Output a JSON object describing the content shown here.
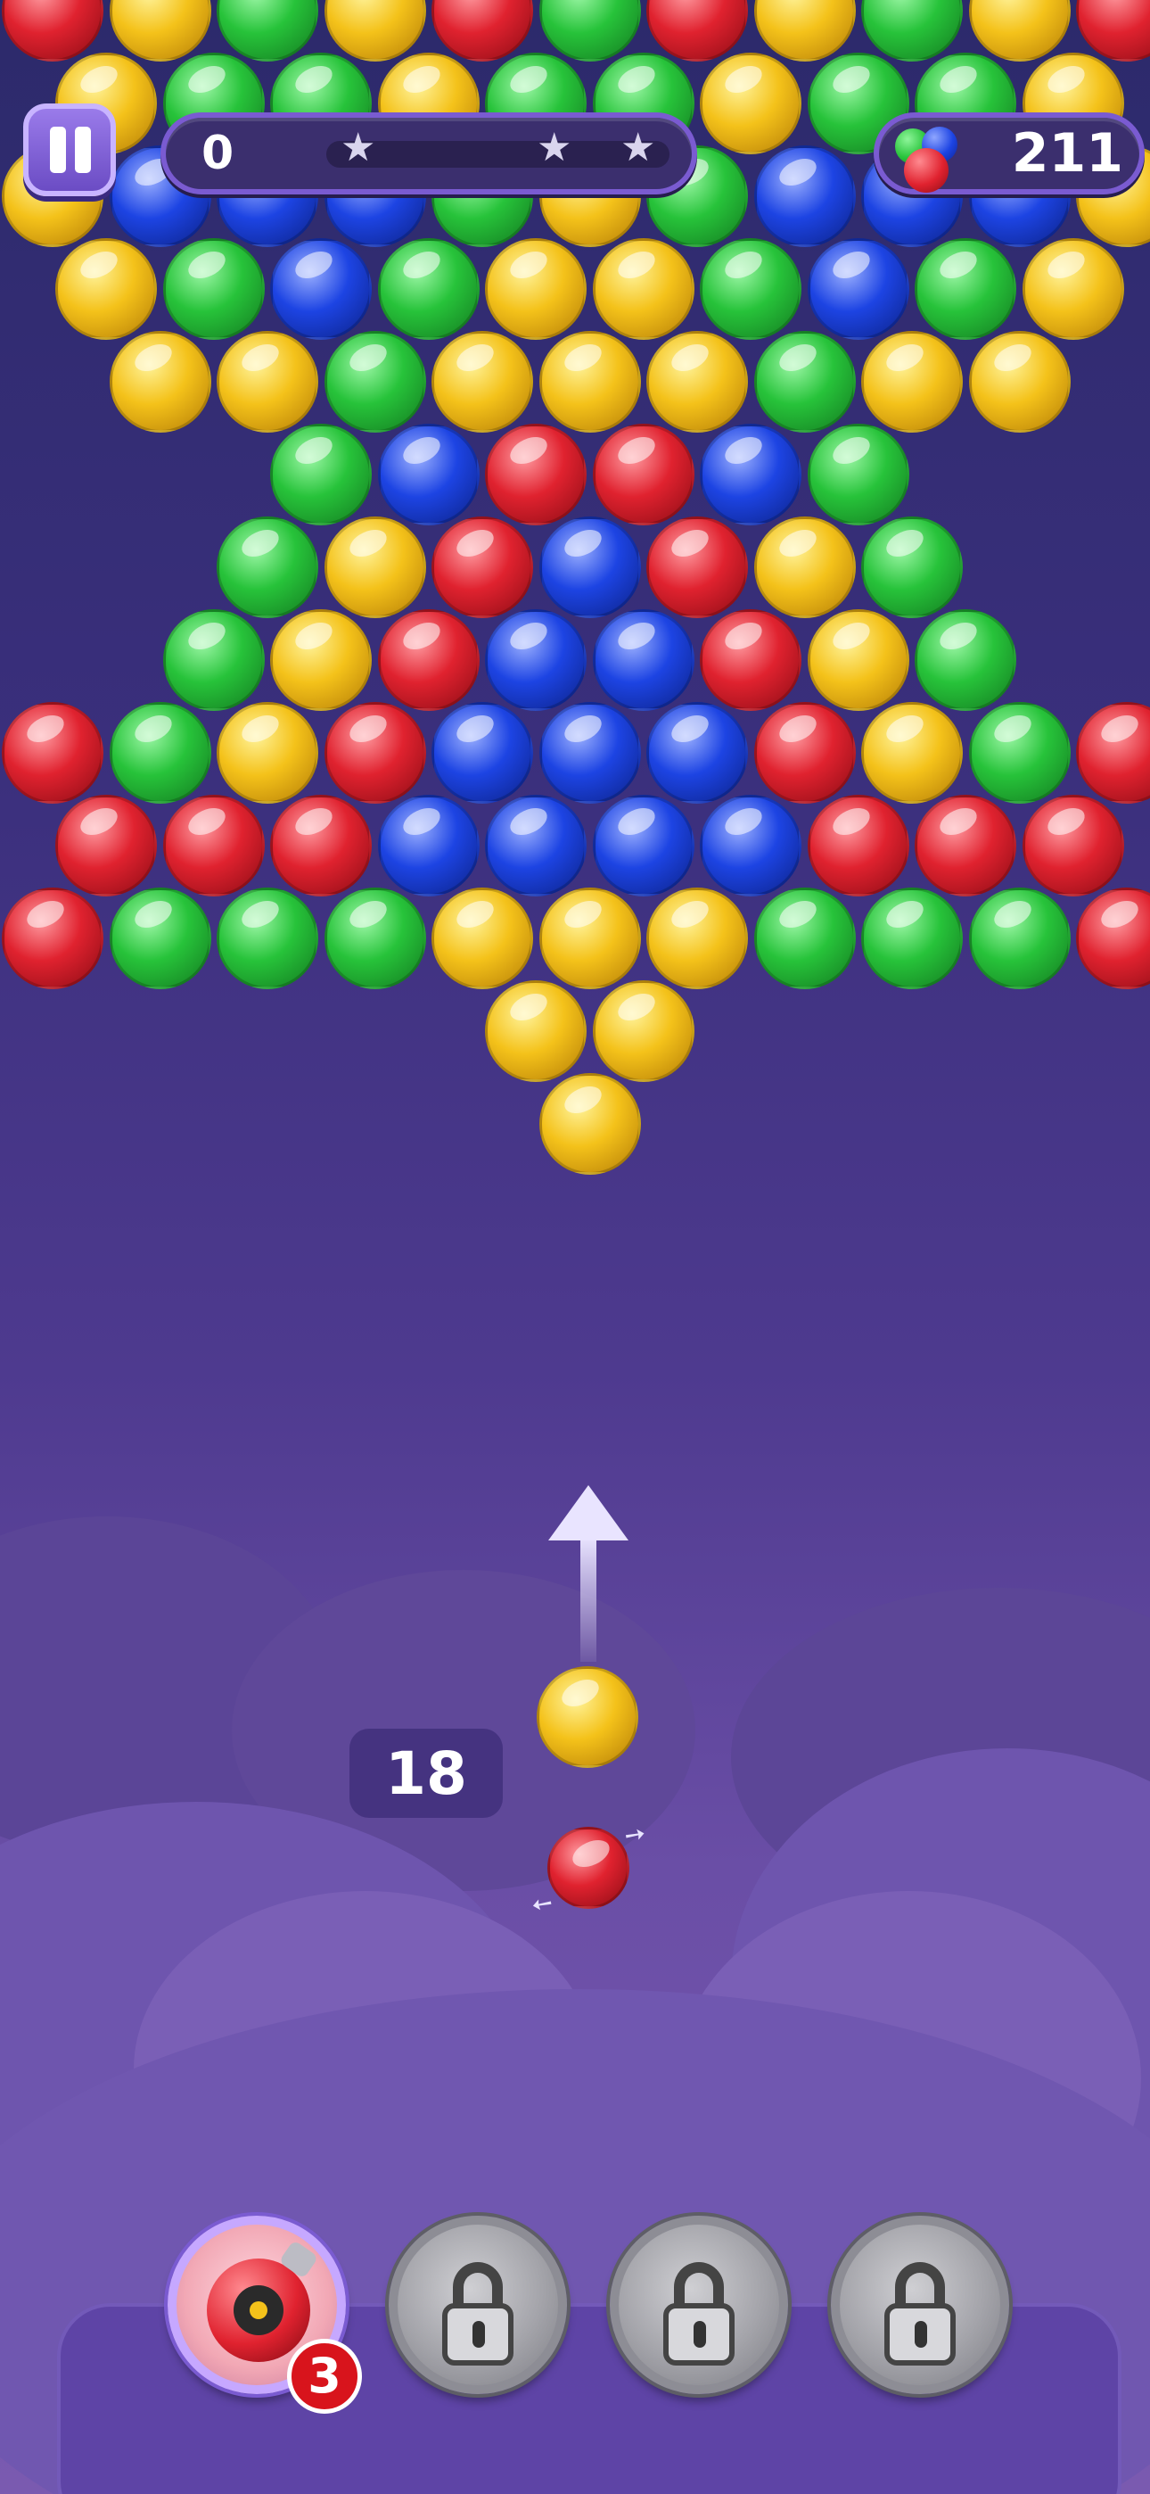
{
  "colors": {
    "red": "#e0222f",
    "green": "#27c33a",
    "blue": "#1d44e3",
    "yellow": "#f4c21a",
    "hud_border": "#7a5bd1",
    "hud_fill": "#3b2f6e",
    "badge_red": "#d8141c"
  },
  "hud": {
    "pause_icon": "pause-icon",
    "score": "0",
    "star_progress": 0.0,
    "stars": 3,
    "bubble_count": "211",
    "bubble_count_icon": "tri-color-bubbles-icon"
  },
  "board": {
    "rows": [
      {
        "offset": 0,
        "colors": [
          "red",
          "yellow",
          "green",
          "yellow",
          "red",
          "green",
          "red",
          "yellow",
          "green",
          "yellow",
          "red"
        ]
      },
      {
        "offset": 1,
        "colors": [
          "yellow",
          "green",
          "green",
          "yellow",
          "green",
          "green",
          "yellow",
          "green",
          "green",
          "yellow"
        ]
      },
      {
        "offset": 0,
        "colors": [
          "yellow",
          "blue",
          "blue",
          "blue",
          "green",
          "yellow",
          "green",
          "blue",
          "blue",
          "blue",
          "yellow"
        ]
      },
      {
        "offset": 1,
        "colors": [
          "yellow",
          "green",
          "blue",
          "green",
          "yellow",
          "yellow",
          "green",
          "blue",
          "green",
          "yellow"
        ]
      },
      {
        "offset": 0,
        "colors": [
          null,
          "yellow",
          "yellow",
          "green",
          "yellow",
          "yellow",
          "yellow",
          "green",
          "yellow",
          "yellow",
          null
        ]
      },
      {
        "offset": 1,
        "colors": [
          null,
          null,
          "green",
          "blue",
          "red",
          "red",
          "blue",
          "green",
          null,
          null
        ]
      },
      {
        "offset": 0,
        "colors": [
          null,
          null,
          "green",
          "yellow",
          "red",
          "blue",
          "red",
          "yellow",
          "green",
          null,
          null
        ]
      },
      {
        "offset": 1,
        "colors": [
          null,
          "green",
          "yellow",
          "red",
          "blue",
          "blue",
          "red",
          "yellow",
          "green",
          null
        ]
      },
      {
        "offset": 0,
        "colors": [
          "red",
          "green",
          "yellow",
          "red",
          "blue",
          "blue",
          "blue",
          "red",
          "yellow",
          "green",
          "red"
        ]
      },
      {
        "offset": 1,
        "colors": [
          "red",
          "red",
          "red",
          "blue",
          "blue",
          "blue",
          "blue",
          "red",
          "red",
          "red"
        ]
      },
      {
        "offset": 0,
        "colors": [
          "red",
          "green",
          "green",
          "green",
          "yellow",
          "yellow",
          "yellow",
          "green",
          "green",
          "green",
          "red"
        ]
      },
      {
        "offset": 1,
        "colors": [
          null,
          null,
          null,
          null,
          "yellow",
          "yellow",
          null,
          null,
          null,
          null
        ]
      },
      {
        "offset": 0,
        "colors": [
          null,
          null,
          null,
          null,
          null,
          "yellow",
          null,
          null,
          null,
          null,
          null
        ]
      }
    ]
  },
  "shooter": {
    "aim_icon": "aim-arrow-icon",
    "current_bubble": "yellow",
    "next_bubble": "red",
    "swap_icon": "swap-arrows-icon",
    "moves_left": "18"
  },
  "boosters": [
    {
      "name": "bomb",
      "icon": "bomb-icon",
      "count": "3",
      "locked": false
    },
    {
      "name": "locked-1",
      "icon": "lock-icon",
      "count": "",
      "locked": true
    },
    {
      "name": "locked-2",
      "icon": "lock-icon",
      "count": "",
      "locked": true
    },
    {
      "name": "locked-3",
      "icon": "lock-icon",
      "count": "",
      "locked": true
    }
  ]
}
